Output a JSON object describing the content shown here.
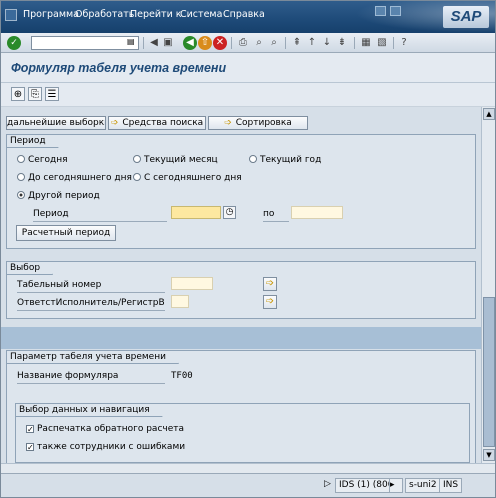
{
  "menu": {
    "items": [
      "Программа",
      "Обработать",
      "Перейти к",
      "Система",
      "Справка"
    ],
    "logo": "SAP"
  },
  "toolbar": {
    "command_value": ""
  },
  "screen": {
    "title": "Формуляр табеля учета времени"
  },
  "selection_buttons": {
    "further": "дальнейшие выборки",
    "search_help": "Средства поиска",
    "sort": "Сортировка"
  },
  "period": {
    "group_title": "Период",
    "options": {
      "today": "Сегодня",
      "current_month": "Текущий месяц",
      "current_year": "Текущий год",
      "until_today": "До сегодняшнего дня",
      "from_today": "С сегодняшнего дня",
      "other": "Другой период"
    },
    "selected": "other",
    "period_label": "Период",
    "to_label": "по",
    "period_from_value": "",
    "period_to_value": "",
    "payroll_period_button": "Расчетный период"
  },
  "selection": {
    "group_title": "Выбор",
    "personnel_number_label": "Табельный номер",
    "personnel_number_value": "",
    "responsible_label": "ОтветстИсполнитель/РегистрВ",
    "responsible_value": ""
  },
  "timesheet_params": {
    "group_title": "Параметр табеля учета времени",
    "form_name_label": "Название формуляра",
    "form_name_value": "TF00",
    "sub_group_title": "Выбор данных и навигация",
    "print_reverse_label": "Распечатка обратного расчета",
    "print_reverse_checked": true,
    "with_errors_label": "также сотрудники с ошибками",
    "with_errors_checked": true
  },
  "status": {
    "system": "IDS (1) (800)",
    "server": "s-uni2",
    "mode": "INS"
  }
}
